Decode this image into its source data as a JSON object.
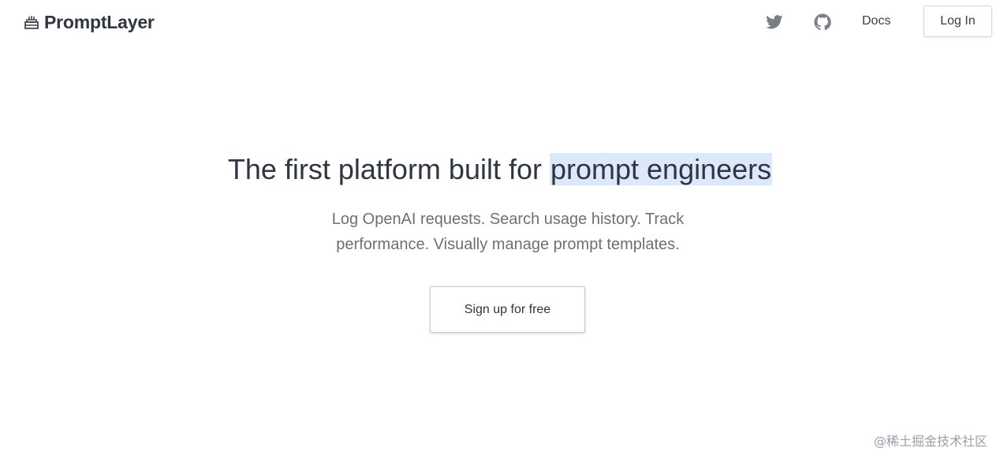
{
  "header": {
    "brand": "PromptLayer",
    "brand_icon": "cake-icon",
    "nav": {
      "twitter_icon": "twitter-icon",
      "github_icon": "github-icon",
      "docs_label": "Docs",
      "login_label": "Log In"
    }
  },
  "hero": {
    "title_plain": "The first platform built for ",
    "title_highlight": "prompt engineers",
    "subtitle": "Log OpenAI requests. Search usage history. Track performance. Visually manage prompt templates.",
    "cta_label": "Sign up for free"
  },
  "watermark": "@稀土掘金技术社区",
  "colors": {
    "text_dark": "#2f3640",
    "text_muted": "#6b7078",
    "highlight_bg": "#dce9fb",
    "icon_gray": "#7a7f86"
  }
}
